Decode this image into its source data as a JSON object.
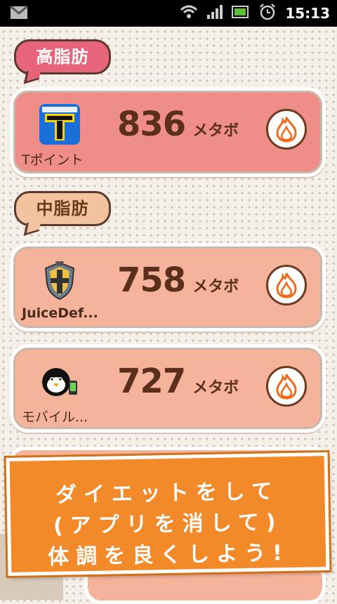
{
  "status_bar": {
    "time": "15:13",
    "icons": [
      "gmail-icon",
      "wifi-icon",
      "signal-icon",
      "battery-icon",
      "alarm-icon"
    ]
  },
  "categories": [
    {
      "label": "高脂肪"
    },
    {
      "label": "中脂肪"
    }
  ],
  "apps": [
    {
      "name": "Tポイント",
      "score": "836",
      "unit": "メタボ",
      "icon": "tpoint-icon"
    },
    {
      "name": "JuiceDef...",
      "score": "758",
      "unit": "メタボ",
      "icon": "juicedefender-icon"
    },
    {
      "name": "モバイル...",
      "score": "727",
      "unit": "メタボ",
      "icon": "suica-penguin-icon"
    }
  ],
  "banner": {
    "line1": "ダイエットをして",
    "line2": "(アプリを消して)",
    "line3": "体調を良くしよう!"
  },
  "colors": {
    "high_fat": "#ef8d89",
    "mid_fat": "#f6b39c",
    "banner": "#f28a2a"
  }
}
